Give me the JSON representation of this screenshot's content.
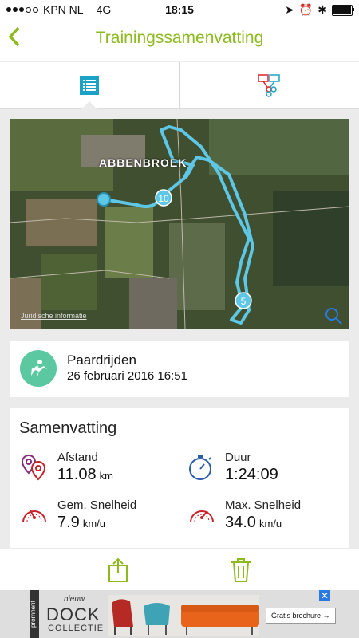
{
  "status_bar": {
    "carrier": "KPN NL",
    "network": "4G",
    "time": "18:15"
  },
  "header": {
    "back_icon": "chevron-left-icon",
    "title": "Trainingssamenvatting"
  },
  "tabs": [
    {
      "icon": "list-icon",
      "active": true
    },
    {
      "icon": "compare-icon",
      "active": false
    }
  ],
  "map": {
    "place_label": "ABBENBROEK",
    "legal_link": "Juridische informatie",
    "markers": [
      "10",
      "5"
    ]
  },
  "activity": {
    "name": "Paardrijden",
    "date": "26 februari 2016 16:51"
  },
  "summary": {
    "heading": "Samenvatting",
    "stats": [
      {
        "label": "Afstand",
        "value": "11.08",
        "unit": "km",
        "icon": "distance-pin-icon"
      },
      {
        "label": "Duur",
        "value": "1:24:09",
        "unit": "",
        "icon": "stopwatch-icon"
      },
      {
        "label": "Gem. Snelheid",
        "value": "7.9",
        "unit": "km/u",
        "icon": "speedometer-icon"
      },
      {
        "label": "Max. Snelheid",
        "value": "34.0",
        "unit": "km/u",
        "icon": "speedometer-icon"
      }
    ]
  },
  "toolbar": {
    "share_icon": "share-icon",
    "delete_icon": "trash-icon"
  },
  "ad": {
    "brand": "promnent",
    "tagline": "nieuw",
    "title": "DOCK",
    "subtitle": "COLLECTIE",
    "cta": "Gratis brochure →"
  },
  "colors": {
    "accent": "#8dba1f",
    "route": "#5fc7e6",
    "activity": "#5cc8a2",
    "icon_blue": "#2b5ea8",
    "icon_red": "#c8222b"
  }
}
